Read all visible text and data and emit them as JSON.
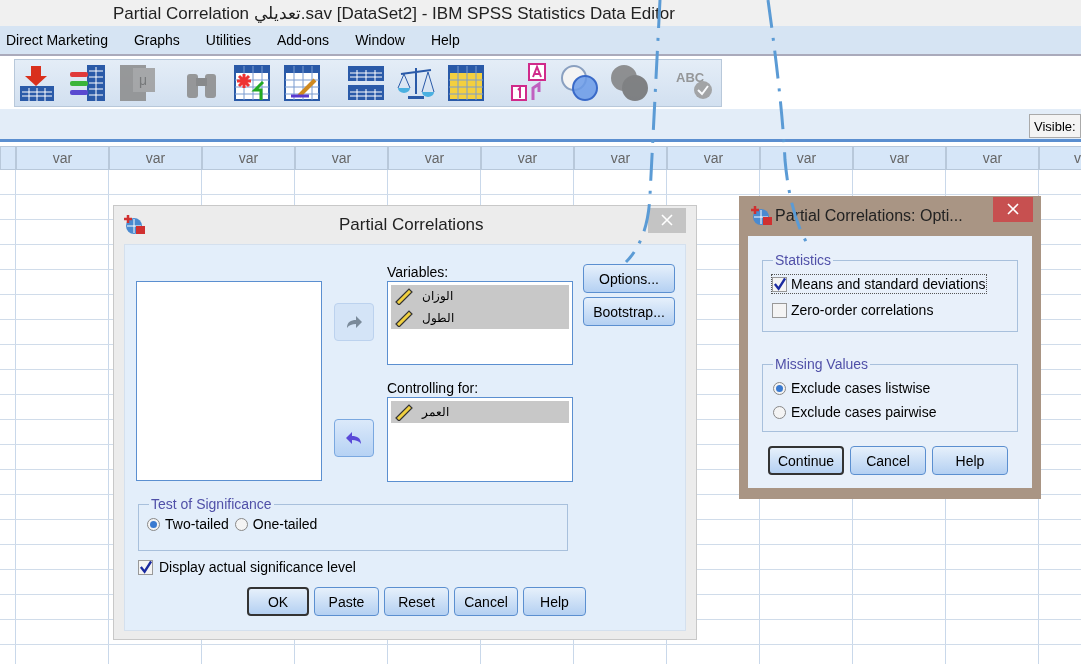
{
  "window": {
    "title": "Partial Correlation تعديلي.sav [DataSet2] - IBM SPSS Statistics Data Editor"
  },
  "menu": [
    "Direct Marketing",
    "Graphs",
    "Utilities",
    "Add-ons",
    "Window",
    "Help"
  ],
  "toolbar": [
    {
      "kind": "import",
      "disabled": false
    },
    {
      "kind": "variables",
      "disabled": false
    },
    {
      "kind": "mu-table",
      "disabled": true,
      "glyph": "μ"
    },
    {
      "kind": "binoculars",
      "disabled": true
    },
    {
      "kind": "insert-cases",
      "disabled": false
    },
    {
      "kind": "select-cases",
      "disabled": false
    },
    {
      "kind": "split-file",
      "disabled": false
    },
    {
      "kind": "scales",
      "disabled": false
    },
    {
      "kind": "value-labels",
      "disabled": false
    },
    {
      "kind": "label-a1",
      "disabled": false
    },
    {
      "kind": "venn",
      "disabled": false
    },
    {
      "kind": "venn",
      "disabled": true
    },
    {
      "kind": "spell",
      "disabled": true,
      "glyph": "ABC"
    }
  ],
  "visible_label": "Visible:",
  "grid": {
    "columns": [
      "var",
      "var",
      "var",
      "var",
      "var",
      "var",
      "var",
      "var",
      "var",
      "var",
      "var",
      "v"
    ]
  },
  "dialog": {
    "title": "Partial Correlations",
    "variables_label": "Variables:",
    "variables": [
      {
        "name": "الوزان",
        "selected": true
      },
      {
        "name": "الطول",
        "selected": true
      }
    ],
    "controlling_label": "Controlling for:",
    "controlling": [
      {
        "name": "العمر",
        "selected": true
      }
    ],
    "move_buttons": [
      {
        "disabled": true
      },
      {
        "disabled": false
      }
    ],
    "side_buttons": [
      "Options...",
      "Bootstrap..."
    ],
    "significance": {
      "title": "Test of Significance",
      "options": [
        {
          "label": "Two-tailed",
          "selected": true
        },
        {
          "label": "One-tailed",
          "selected": false
        }
      ]
    },
    "display_actual": {
      "label": "Display actual significance level",
      "checked": true
    },
    "buttons": [
      {
        "label": "OK",
        "default": true
      },
      {
        "label": "Paste",
        "default": false
      },
      {
        "label": "Reset",
        "default": false
      },
      {
        "label": "Cancel",
        "default": false
      },
      {
        "label": "Help",
        "default": false
      }
    ]
  },
  "options_dialog": {
    "title": "Partial Correlations: Opti...",
    "statistics": {
      "title": "Statistics",
      "items": [
        {
          "label": "Means and standard deviations",
          "checked": true
        },
        {
          "label": "Zero-order correlations",
          "checked": false
        }
      ]
    },
    "missing": {
      "title": "Missing Values",
      "options": [
        {
          "label": "Exclude cases listwise",
          "selected": true
        },
        {
          "label": "Exclude cases pairwise",
          "selected": false
        }
      ]
    },
    "buttons": [
      {
        "label": "Continue",
        "default": true
      },
      {
        "label": "Cancel",
        "default": false
      },
      {
        "label": "Help",
        "default": false
      }
    ]
  }
}
